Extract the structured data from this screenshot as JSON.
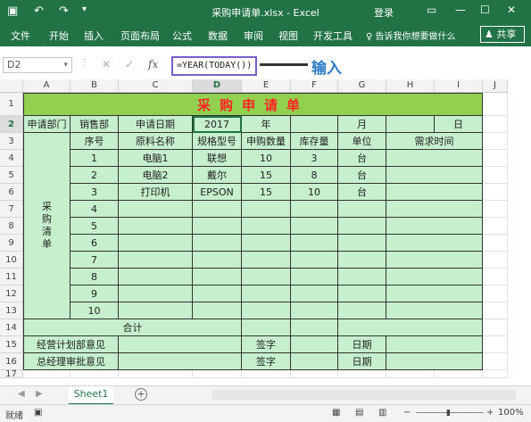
{
  "window": {
    "title": "采购申请单.xlsx - Excel",
    "login": "登录"
  },
  "ribbon": {
    "tabs": [
      "文件",
      "开始",
      "插入",
      "页面布局",
      "公式",
      "数据",
      "审阅",
      "视图",
      "开发工具"
    ],
    "tell_me": "告诉我你想要做什么",
    "share": "共享"
  },
  "formula_bar": {
    "name_box": "D2",
    "fx": "fx",
    "formula": "=YEAR(TODAY())"
  },
  "annotation": {
    "label": "输入"
  },
  "columns": [
    "A",
    "B",
    "C",
    "D",
    "E",
    "F",
    "G",
    "H",
    "I",
    "J"
  ],
  "rows": [
    "1",
    "2",
    "3",
    "4",
    "5",
    "6",
    "7",
    "8",
    "9",
    "10",
    "11",
    "12",
    "13",
    "14",
    "15",
    "16",
    "17"
  ],
  "form": {
    "title": "采购申请单",
    "dept_label": "申请部门",
    "dept_value": "销售部",
    "date_label": "申请日期",
    "year_value": "2017",
    "year_unit": "年",
    "month_unit": "月",
    "day_unit": "日",
    "side_label": "采购清单",
    "headers": [
      "序号",
      "原料名称",
      "规格型号",
      "申购数量",
      "库存量",
      "单位",
      "需求时间"
    ],
    "items": [
      [
        "1",
        "电脑1",
        "联想",
        "10",
        "3",
        "台",
        ""
      ],
      [
        "2",
        "电脑2",
        "戴尔",
        "15",
        "8",
        "台",
        ""
      ],
      [
        "3",
        "打印机",
        "EPSON",
        "15",
        "10",
        "台",
        ""
      ],
      [
        "4",
        "",
        "",
        "",
        "",
        "",
        ""
      ],
      [
        "5",
        "",
        "",
        "",
        "",
        "",
        ""
      ],
      [
        "6",
        "",
        "",
        "",
        "",
        "",
        ""
      ],
      [
        "7",
        "",
        "",
        "",
        "",
        "",
        ""
      ],
      [
        "8",
        "",
        "",
        "",
        "",
        "",
        ""
      ],
      [
        "9",
        "",
        "",
        "",
        "",
        "",
        ""
      ],
      [
        "10",
        "",
        "",
        "",
        "",
        "",
        ""
      ]
    ],
    "total_label": "合计",
    "plan_label": "经营计划部意见",
    "gm_label": "总经理审批意见",
    "sign_label": "签字",
    "date2_label": "日期"
  },
  "sheets": [
    "Sheet1"
  ],
  "status": {
    "ready": "就绪",
    "zoom": "100%"
  }
}
